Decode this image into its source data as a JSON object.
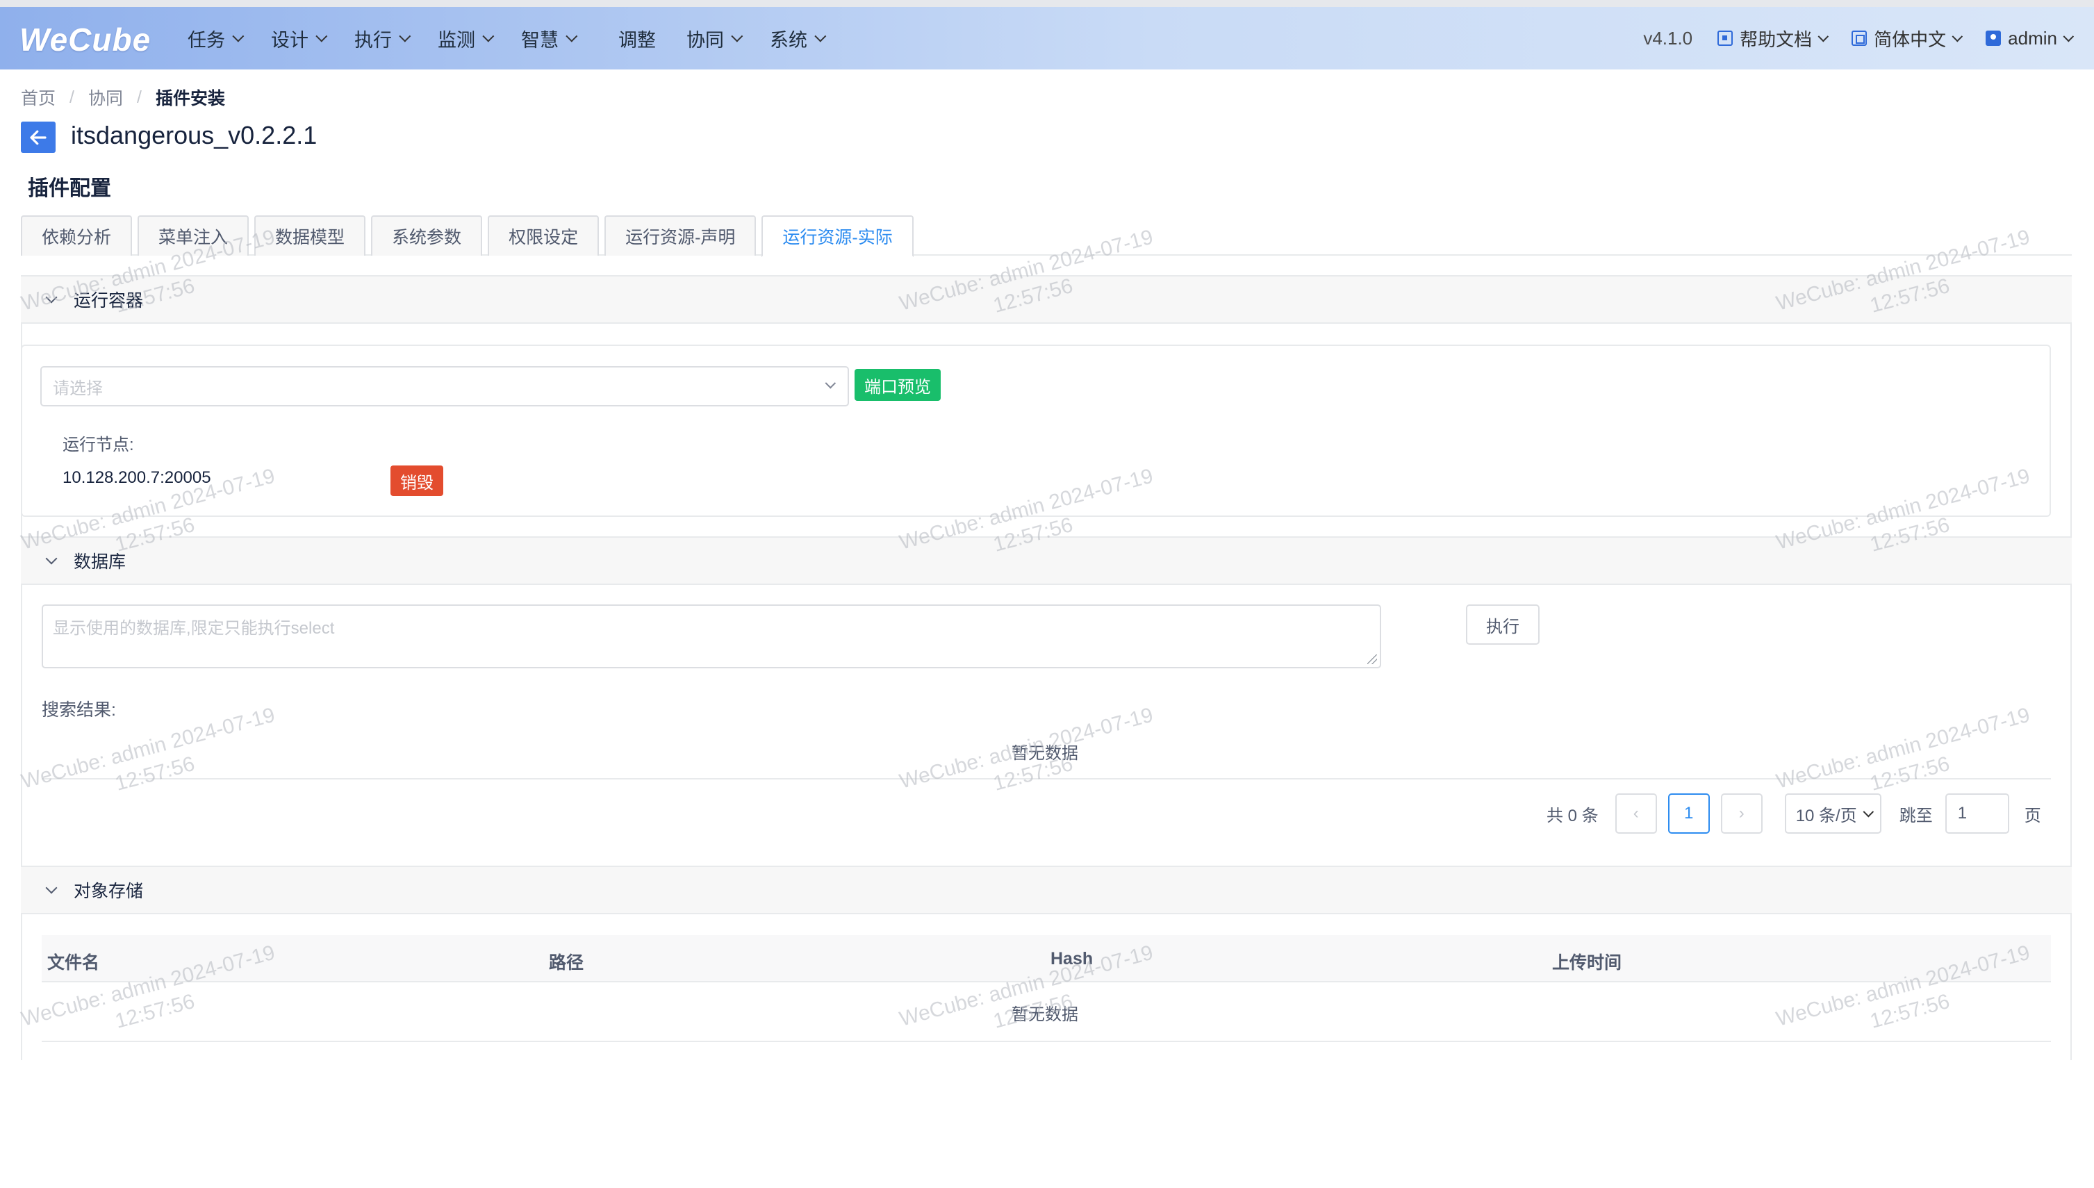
{
  "app": {
    "logo": "WeCube",
    "version": "v4.1.0"
  },
  "nav": {
    "items": [
      {
        "label": "任务"
      },
      {
        "label": "设计"
      },
      {
        "label": "执行"
      },
      {
        "label": "监测"
      },
      {
        "label": "智慧"
      },
      {
        "label": "调整"
      },
      {
        "label": "协同"
      },
      {
        "label": "系统"
      }
    ],
    "help": "帮助文档",
    "language": "简体中文",
    "user": "admin"
  },
  "breadcrumb": {
    "home": "首页",
    "parent": "协同",
    "current": "插件安装"
  },
  "page": {
    "title": "itsdangerous_v0.2.2.1",
    "section": "插件配置"
  },
  "tabs": [
    {
      "label": "依赖分析"
    },
    {
      "label": "菜单注入"
    },
    {
      "label": "数据模型"
    },
    {
      "label": "系统参数"
    },
    {
      "label": "权限设定"
    },
    {
      "label": "运行资源-声明"
    },
    {
      "label": "运行资源-实际",
      "active": true
    }
  ],
  "container": {
    "title": "运行容器",
    "select_placeholder": "请选择",
    "port_preview": "端口预览",
    "node_label": "运行节点:",
    "node_value": "10.128.200.7:20005",
    "destroy": "销毁"
  },
  "database": {
    "title": "数据库",
    "placeholder": "显示使用的数据库,限定只能执行select",
    "execute": "执行",
    "result_label": "搜索结果:",
    "empty": "暂无数据",
    "pager": {
      "total": "共 0 条",
      "current_page": "1",
      "page_size": "10 条/页",
      "jump_label": "跳至",
      "jump_value": "1",
      "page_unit": "页"
    }
  },
  "storage": {
    "title": "对象存储",
    "columns": [
      "文件名",
      "路径",
      "Hash",
      "上传时间"
    ],
    "empty": "暂无数据"
  },
  "watermark": {
    "line1": "WeCube: admin 2024-07-19",
    "line2": "12:57:56"
  },
  "colors": {
    "accent": "#2d8cf0",
    "success": "#19be6b",
    "danger": "#e34c2e",
    "back_button": "#3d7ae8"
  }
}
